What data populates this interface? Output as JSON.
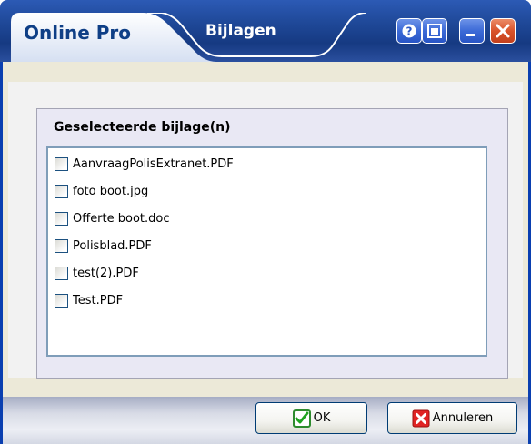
{
  "window": {
    "app_name": "Online Pro",
    "title": "Bijlagen",
    "title_buttons": {
      "help": "help-icon",
      "restore": "restore-icon",
      "minimize": "minimize-icon",
      "close": "close-icon"
    }
  },
  "group": {
    "title": "Geselecteerde bijlage(n)"
  },
  "attachments": [
    {
      "name": "AanvraagPolisExtranet.PDF",
      "checked": false
    },
    {
      "name": "foto boot.jpg",
      "checked": false
    },
    {
      "name": "Offerte boot.doc",
      "checked": false
    },
    {
      "name": "Polisblad.PDF",
      "checked": false
    },
    {
      "name": "test(2).PDF",
      "checked": false
    },
    {
      "name": "Test.PDF",
      "checked": false
    }
  ],
  "buttons": {
    "ok_label": "OK",
    "ok_icon": "green-check-icon",
    "cancel_label": "Annuleren",
    "cancel_icon": "red-x-icon"
  },
  "colors": {
    "titlebar": "#1e4796",
    "frame_border": "#0a3fb0",
    "group_background": "#e9e8f4",
    "list_border": "#7f9db9"
  }
}
